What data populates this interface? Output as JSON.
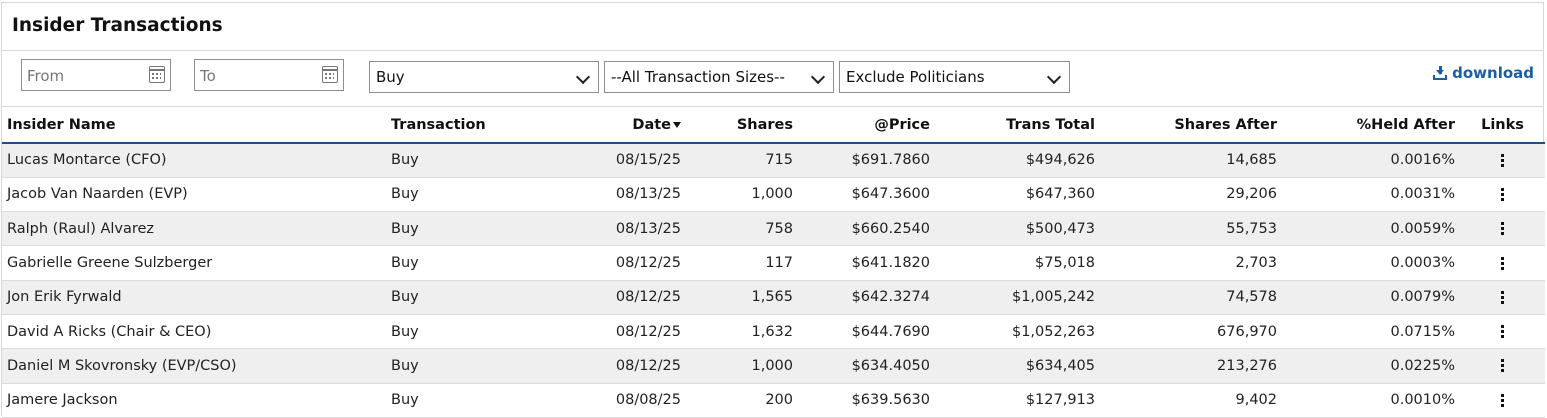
{
  "title": "Insider Transactions",
  "filters": {
    "from_placeholder": "From",
    "to_placeholder": "To",
    "type_value": "Buy",
    "size_value": "--All Transaction Sizes--",
    "politicians_value": "Exclude Politicians",
    "download_label": "download"
  },
  "table": {
    "headers": {
      "insider_name": "Insider Name",
      "transaction": "Transaction",
      "date": "Date",
      "shares": "Shares",
      "price": "@Price",
      "trans_total": "Trans Total",
      "shares_after": "Shares After",
      "held_after": "%Held After",
      "links": "Links"
    },
    "sort": {
      "column": "date",
      "direction": "descending"
    },
    "rows": [
      {
        "name": "Lucas Montarce (CFO)",
        "transaction": "Buy",
        "date": "08/15/25",
        "shares": "715",
        "price": "$691.7860",
        "total": "$494,626",
        "shares_after": "14,685",
        "held_after": "0.0016%"
      },
      {
        "name": "Jacob Van Naarden (EVP)",
        "transaction": "Buy",
        "date": "08/13/25",
        "shares": "1,000",
        "price": "$647.3600",
        "total": "$647,360",
        "shares_after": "29,206",
        "held_after": "0.0031%"
      },
      {
        "name": "Ralph (Raul) Alvarez",
        "transaction": "Buy",
        "date": "08/13/25",
        "shares": "758",
        "price": "$660.2540",
        "total": "$500,473",
        "shares_after": "55,753",
        "held_after": "0.0059%"
      },
      {
        "name": "Gabrielle Greene Sulzberger",
        "transaction": "Buy",
        "date": "08/12/25",
        "shares": "117",
        "price": "$641.1820",
        "total": "$75,018",
        "shares_after": "2,703",
        "held_after": "0.0003%"
      },
      {
        "name": "Jon Erik Fyrwald",
        "transaction": "Buy",
        "date": "08/12/25",
        "shares": "1,565",
        "price": "$642.3274",
        "total": "$1,005,242",
        "shares_after": "74,578",
        "held_after": "0.0079%"
      },
      {
        "name": "David A Ricks (Chair & CEO)",
        "transaction": "Buy",
        "date": "08/12/25",
        "shares": "1,632",
        "price": "$644.7690",
        "total": "$1,052,263",
        "shares_after": "676,970",
        "held_after": "0.0715%"
      },
      {
        "name": "Daniel M Skovronsky (EVP/CSO)",
        "transaction": "Buy",
        "date": "08/12/25",
        "shares": "1,000",
        "price": "$634.4050",
        "total": "$634,405",
        "shares_after": "213,276",
        "held_after": "0.0225%"
      },
      {
        "name": "Jamere Jackson",
        "transaction": "Buy",
        "date": "08/08/25",
        "shares": "200",
        "price": "$639.5630",
        "total": "$127,913",
        "shares_after": "9,402",
        "held_after": "0.0010%"
      }
    ]
  },
  "colors": {
    "link_blue": "#1a5ea8",
    "header_rule": "#1e4f8a",
    "stripe": "#efefef"
  },
  "icons": {
    "calendar": "calendar-icon",
    "dropdown": "chevron-down-icon",
    "download": "download-icon",
    "row_menu": "kebab-menu-icon",
    "sort": "sort-descending-icon"
  }
}
